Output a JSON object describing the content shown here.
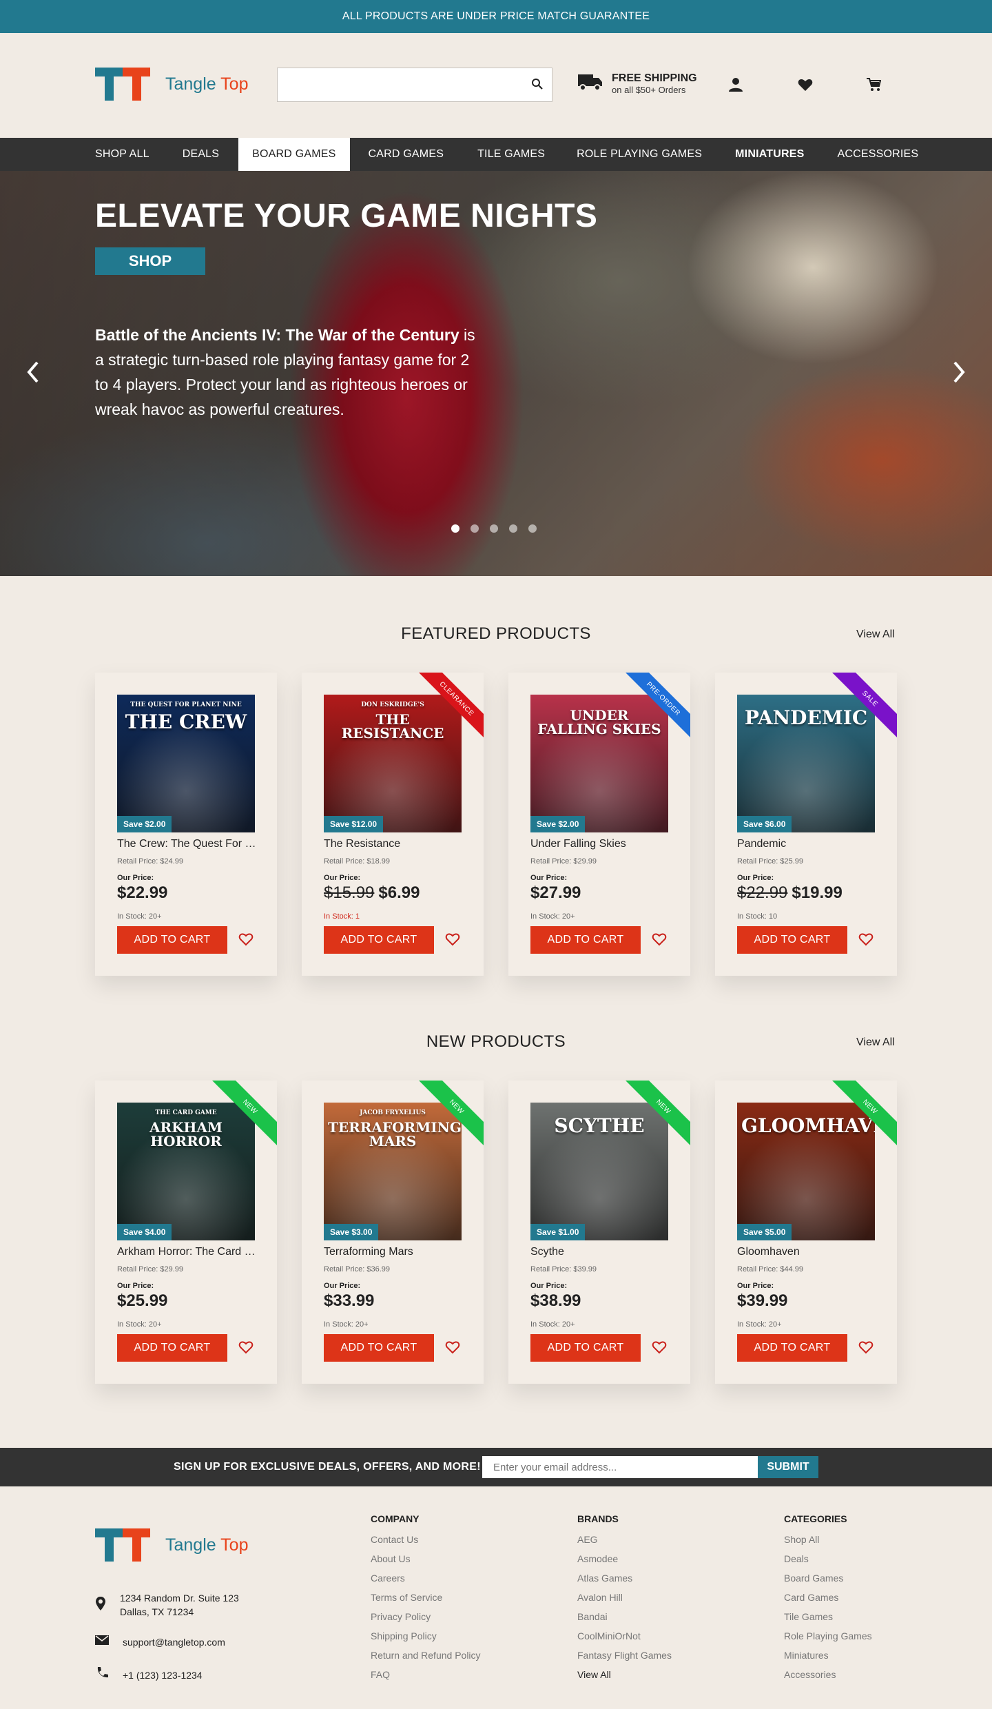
{
  "announcement": "ALL PRODUCTS ARE UNDER PRICE MATCH GUARANTEE",
  "brand": {
    "name_part1": "Tangle",
    "name_part2": "Top",
    "color_teal": "#22798f",
    "color_orange": "#e8431b"
  },
  "search": {
    "placeholder": "",
    "icon": "search-icon"
  },
  "shipping": {
    "title": "FREE SHIPPING",
    "subtitle": "on all $50+ Orders",
    "icon": "truck-icon"
  },
  "header_icons": [
    "account-icon",
    "heart-icon",
    "cart-icon"
  ],
  "nav": {
    "items": [
      "SHOP ALL",
      "DEALS",
      "BOARD GAMES",
      "CARD GAMES",
      "TILE GAMES",
      "ROLE PLAYING GAMES",
      "MINIATURES",
      "ACCESSORIES"
    ],
    "active": "BOARD GAMES"
  },
  "hero": {
    "title": "ELEVATE YOUR GAME NIGHTS",
    "button": "SHOP",
    "desc_bold": "Battle of the Ancients IV: The War of the Century",
    "desc": "is a strategic turn-based role playing fantasy game for 2 to 4 players. Protect your land as righteous heroes or wreak havoc as powerful creatures.",
    "slides": 5,
    "active_slide": 1
  },
  "featured": {
    "title": "FEATURED PRODUCTS",
    "view_all": "View All",
    "products": [
      {
        "name": "The Crew: The Quest For Planet Nine",
        "cover_title": "THE CREW",
        "cover_sub": "THE QUEST FOR PLANET NINE",
        "save": "Save $2.00",
        "retail": "Retail Price: $24.99",
        "our_label": "Our Price:",
        "old_price": "",
        "price": "$22.99",
        "stock": "In Stock: 20+",
        "stock_low": false,
        "ribbon": "",
        "cover_bg": "#0e2a5a",
        "cart": "ADD TO CART"
      },
      {
        "name": "The Resistance",
        "cover_title": "THE RESISTANCE",
        "cover_sub": "DON ESKRIDGE'S",
        "save": "Save $12.00",
        "retail": "Retail Price: $18.99",
        "our_label": "Our Price:",
        "old_price": "$15.99",
        "price": "$6.99",
        "stock": "In Stock: 1",
        "stock_low": true,
        "ribbon": "CLEARANCE",
        "ribbon_color": "#d9141a",
        "cover_bg": "#b11a1a",
        "cart": "ADD TO CART"
      },
      {
        "name": "Under Falling Skies",
        "cover_title": "UNDER FALLING SKIES",
        "cover_sub": "",
        "save": "Save $2.00",
        "retail": "Retail Price: $29.99",
        "our_label": "Our Price:",
        "old_price": "",
        "price": "$27.99",
        "stock": "In Stock: 20+",
        "stock_low": false,
        "ribbon": "PRE-ORDER",
        "ribbon_color": "#1e6fd9",
        "cover_bg": "#b8324a",
        "cart": "ADD TO CART"
      },
      {
        "name": "Pandemic",
        "cover_title": "PANDEMIC",
        "cover_sub": "",
        "save": "Save $6.00",
        "retail": "Retail Price: $25.99",
        "our_label": "Our Price:",
        "old_price": "$22.99",
        "price": "$19.99",
        "stock": "In Stock: 10",
        "stock_low": false,
        "ribbon": "SALE",
        "ribbon_color": "#7a12c9",
        "cover_bg": "#2d6f86",
        "cart": "ADD TO CART"
      }
    ]
  },
  "new": {
    "title": "NEW PRODUCTS",
    "view_all": "View All",
    "products": [
      {
        "name": "Arkham Horror: The Card Game",
        "cover_title": "ARKHAM HORROR",
        "cover_sub": "THE CARD GAME",
        "save": "Save $4.00",
        "retail": "Retail Price: $29.99",
        "our_label": "Our Price:",
        "old_price": "",
        "price": "$25.99",
        "stock": "In Stock: 20+",
        "stock_low": false,
        "ribbon": "NEW",
        "ribbon_color": "#1bc24a",
        "cover_bg": "#1d3d3a",
        "cart": "ADD TO CART"
      },
      {
        "name": "Terraforming Mars",
        "cover_title": "TERRAFORMING MARS",
        "cover_sub": "JACOB FRYXELIUS",
        "save": "Save $3.00",
        "retail": "Retail Price: $36.99",
        "our_label": "Our Price:",
        "old_price": "",
        "price": "$33.99",
        "stock": "In Stock: 20+",
        "stock_low": false,
        "ribbon": "NEW",
        "ribbon_color": "#1bc24a",
        "cover_bg": "#c26a3a",
        "cart": "ADD TO CART"
      },
      {
        "name": "Scythe",
        "cover_title": "SCYTHE",
        "cover_sub": "",
        "save": "Save $1.00",
        "retail": "Retail Price: $39.99",
        "our_label": "Our Price:",
        "old_price": "",
        "price": "$38.99",
        "stock": "In Stock: 20+",
        "stock_low": false,
        "ribbon": "NEW",
        "ribbon_color": "#1bc24a",
        "cover_bg": "#6e7270",
        "cart": "ADD TO CART"
      },
      {
        "name": "Gloomhaven",
        "cover_title": "GLOOMHAVEN",
        "cover_sub": "",
        "save": "Save $5.00",
        "retail": "Retail Price: $44.99",
        "our_label": "Our Price:",
        "old_price": "",
        "price": "$39.99",
        "stock": "In Stock: 20+",
        "stock_low": false,
        "ribbon": "NEW",
        "ribbon_color": "#1bc24a",
        "cover_bg": "#8a2a14",
        "cart": "ADD TO CART"
      }
    ]
  },
  "newsletter": {
    "text": "SIGN UP FOR EXCLUSIVE DEALS, OFFERS, AND MORE!",
    "placeholder": "Enter your email address...",
    "button": "SUBMIT"
  },
  "footer": {
    "address_line1": "1234 Random Dr. Suite 123",
    "address_line2": "Dallas, TX 71234",
    "email": "support@tangletop.com",
    "phone": "+1 (123) 123-1234",
    "columns": [
      {
        "title": "COMPANY",
        "links": [
          "Contact Us",
          "About Us",
          "Careers",
          "Terms of Service",
          "Privacy Policy",
          "Shipping Policy",
          "Return and Refund Policy",
          "FAQ"
        ]
      },
      {
        "title": "BRANDS",
        "links": [
          "AEG",
          "Asmodee",
          "Atlas Games",
          "Avalon Hill",
          "Bandai",
          "CoolMiniOrNot",
          "Fantasy Flight Games",
          "View All"
        ]
      },
      {
        "title": "CATEGORIES",
        "links": [
          "Shop All",
          "Deals",
          "Board Games",
          "Card Games",
          "Tile Games",
          "Role Playing Games",
          "Miniatures",
          "Accessories"
        ]
      }
    ]
  }
}
